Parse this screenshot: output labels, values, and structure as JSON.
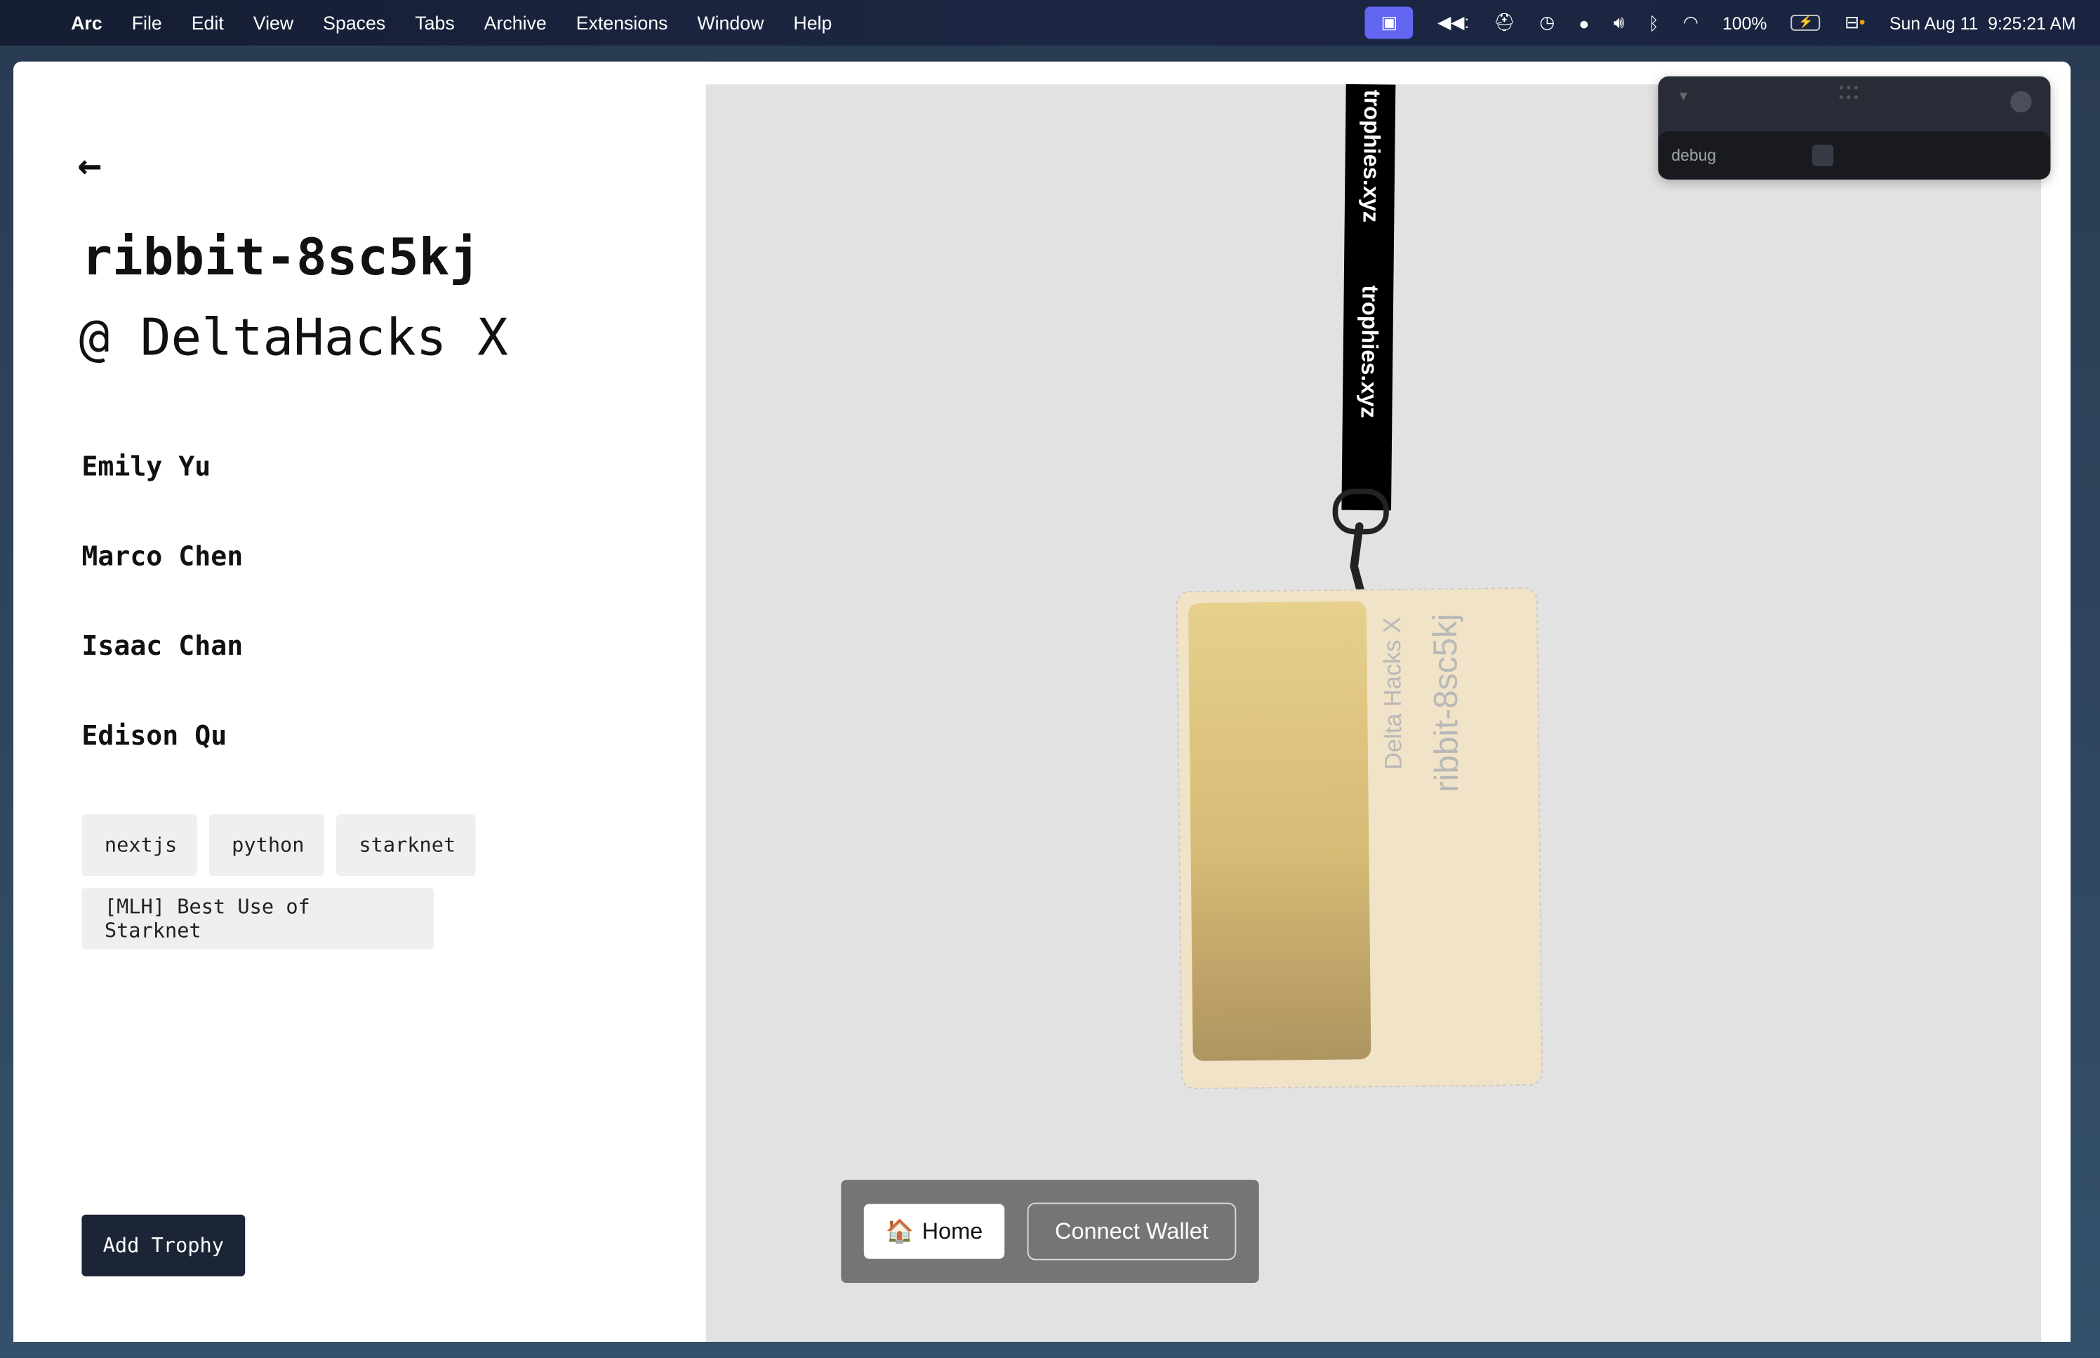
{
  "menubar": {
    "apple": "",
    "app": "Arc",
    "items": [
      "File",
      "Edit",
      "View",
      "Spaces",
      "Tabs",
      "Archive",
      "Extensions",
      "Window",
      "Help"
    ],
    "battery": "100%",
    "datetime": "Sun Aug 11  9:25:21 AM"
  },
  "project": {
    "back_icon": "arrow-left-icon",
    "title": "ribbit-8sc5kj",
    "event": "@ DeltaHacks X",
    "members": [
      "Emily Yu",
      "Marco Chen",
      "Isaac Chan",
      "Edison Qu"
    ],
    "tags": [
      "nextjs",
      "python",
      "starknet"
    ],
    "prize": "[MLH] Best Use of Starknet",
    "add_button": "Add Trophy"
  },
  "debug": {
    "label": "debug",
    "checked": false
  },
  "lanyard": {
    "text1": "trophies.xyz",
    "text2": "trophies.xyz"
  },
  "card": {
    "event": "Delta Hacks X",
    "title": "ribbit-8sc5kj"
  },
  "bottom": {
    "home_emoji": "🏠",
    "home": "Home",
    "wallet": "Connect Wallet"
  },
  "colors": {
    "canvas": "#e2e2e2",
    "card": "#f1e3c8",
    "gold": "#d5bb75",
    "button": "#1c2535"
  }
}
